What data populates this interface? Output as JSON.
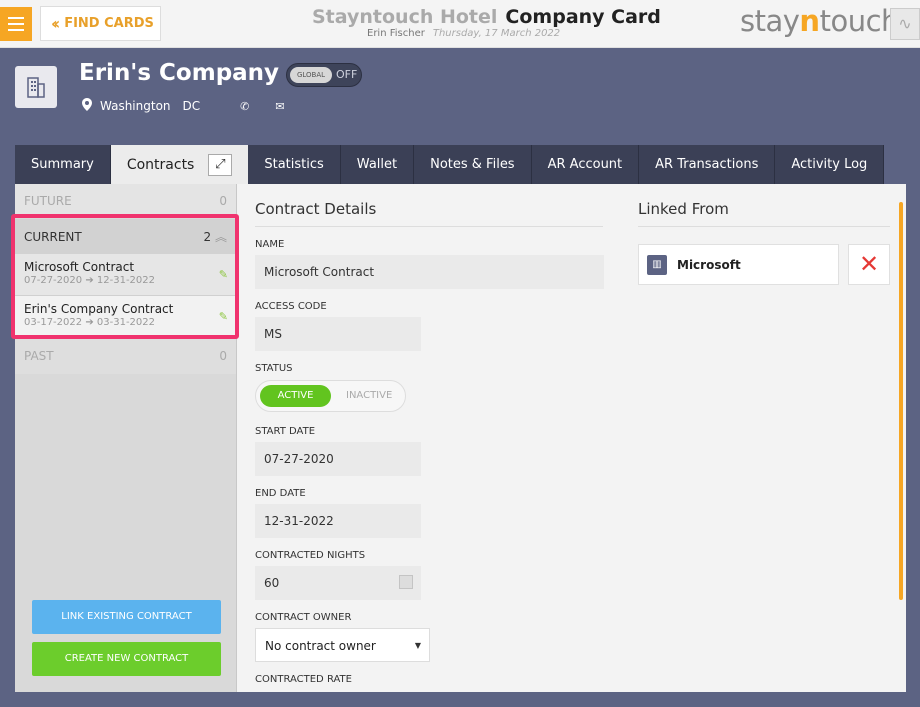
{
  "header": {
    "find_cards": "FIND CARDS",
    "hotel": "Stayntouch Hotel",
    "page": "Company Card",
    "user": "Erin Fischer",
    "date": "Thursday, 17 March 2022",
    "logo_pre": "stay",
    "logo_n": "n",
    "logo_post": "touch"
  },
  "company": {
    "name": "Erin's Company",
    "global_label": "GLOBAL",
    "global_state": "OFF",
    "city": "Washington",
    "state": "DC",
    "icons": [
      "building-icon",
      "map-pin-icon",
      "phone-icon",
      "mail-icon"
    ]
  },
  "tabs": [
    {
      "label": "Summary"
    },
    {
      "label": "Contracts"
    },
    {
      "label": "Statistics"
    },
    {
      "label": "Wallet"
    },
    {
      "label": "Notes & Files"
    },
    {
      "label": "AR Account"
    },
    {
      "label": "AR Transactions"
    },
    {
      "label": "Activity Log"
    }
  ],
  "sidebar": {
    "future": {
      "label": "FUTURE",
      "count": "0"
    },
    "current": {
      "label": "CURRENT",
      "count": "2"
    },
    "past": {
      "label": "PAST",
      "count": "0"
    },
    "contracts": [
      {
        "name": "Microsoft Contract",
        "start": "07-27-2020",
        "end": "12-31-2022"
      },
      {
        "name": "Erin's Company Contract",
        "start": "03-17-2022",
        "end": "03-31-2022"
      }
    ],
    "link_button": "LINK EXISTING CONTRACT",
    "create_button": "CREATE NEW CONTRACT"
  },
  "details": {
    "title": "Contract Details",
    "name_label": "NAME",
    "name_value": "Microsoft Contract",
    "access_label": "ACCESS CODE",
    "access_value": "MS",
    "status_label": "STATUS",
    "status_active": "ACTIVE",
    "status_inactive": "INACTIVE",
    "start_label": "START DATE",
    "start_value": "07-27-2020",
    "end_label": "END DATE",
    "end_value": "12-31-2022",
    "nights_label": "CONTRACTED NIGHTS",
    "nights_value": "60",
    "owner_label": "CONTRACT OWNER",
    "owner_value": "No contract owner",
    "rate_label": "CONTRACTED RATE"
  },
  "linked": {
    "title": "Linked From",
    "company": "Microsoft"
  },
  "colors": {
    "accent": "#f6a623",
    "highlight": "#f0336e",
    "active_green": "#62c41f",
    "link_blue": "#5bb3ee"
  }
}
